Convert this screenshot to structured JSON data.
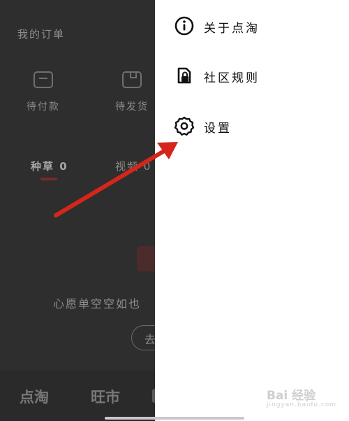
{
  "background": {
    "orders_title": "我的订单",
    "order_items": [
      {
        "label": "待付款",
        "icon": "wallet-icon"
      },
      {
        "label": "待发货",
        "icon": "package-icon"
      }
    ],
    "tabs": [
      {
        "label": "种草 0",
        "active": true
      },
      {
        "label": "视频 0",
        "active": false
      }
    ],
    "empty_text": "心愿单空空如也",
    "empty_button": "去",
    "bottom_nav": [
      "点淘",
      "旺市"
    ]
  },
  "side_menu": {
    "items": [
      {
        "label": "关于点淘",
        "icon": "info-icon"
      },
      {
        "label": "社区规则",
        "icon": "lock-doc-icon"
      },
      {
        "label": "设置",
        "icon": "gear-icon"
      }
    ]
  },
  "watermark": {
    "text": "Bai 经验",
    "sub": "jingyan.baidu.com"
  },
  "colors": {
    "panel": "#ffffff",
    "overlay": "#2e2e2e",
    "arrow": "#d4261a",
    "tab_underline": "#7a2a26"
  }
}
